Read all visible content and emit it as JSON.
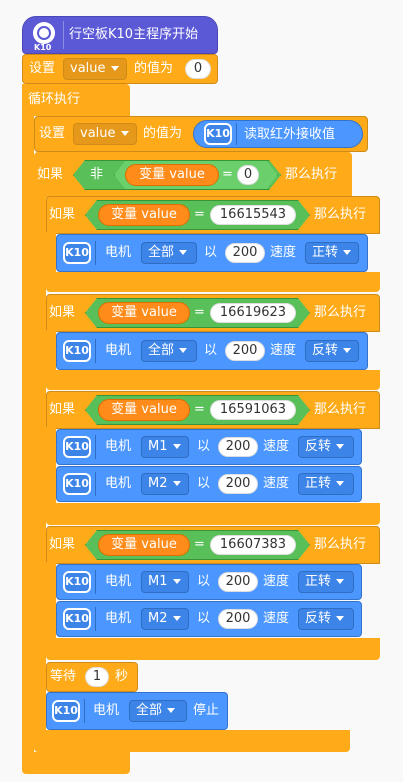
{
  "hat": {
    "icon_label": "K10",
    "label": "行空板K10主程序开始"
  },
  "set_top": {
    "prefix": "设置",
    "var": "value",
    "mid": "的值为",
    "value": "0"
  },
  "loop": {
    "label": "循环执行"
  },
  "set_ir": {
    "prefix": "设置",
    "var": "value",
    "mid": "的值为",
    "reporter": "读取红外接收值"
  },
  "if_not": {
    "if": "如果",
    "not": "非",
    "var": "变量 value",
    "eq": "=",
    "value": "0",
    "then": "那么执行"
  },
  "if_blocks": [
    {
      "if": "如果",
      "var": "变量 value",
      "eq": "=",
      "value": "16615543",
      "then": "那么执行",
      "motors": [
        {
          "label": "电机",
          "motor": "全部",
          "with": "以",
          "speed": "200",
          "speed_label": "速度",
          "dir": "正转"
        }
      ]
    },
    {
      "if": "如果",
      "var": "变量 value",
      "eq": "=",
      "value": "16619623",
      "then": "那么执行",
      "motors": [
        {
          "label": "电机",
          "motor": "全部",
          "with": "以",
          "speed": "200",
          "speed_label": "速度",
          "dir": "反转"
        }
      ]
    },
    {
      "if": "如果",
      "var": "变量 value",
      "eq": "=",
      "value": "16591063",
      "then": "那么执行",
      "motors": [
        {
          "label": "电机",
          "motor": "M1",
          "with": "以",
          "speed": "200",
          "speed_label": "速度",
          "dir": "反转"
        },
        {
          "label": "电机",
          "motor": "M2",
          "with": "以",
          "speed": "200",
          "speed_label": "速度",
          "dir": "正转"
        }
      ]
    },
    {
      "if": "如果",
      "var": "变量 value",
      "eq": "=",
      "value": "16607383",
      "then": "那么执行",
      "motors": [
        {
          "label": "电机",
          "motor": "M1",
          "with": "以",
          "speed": "200",
          "speed_label": "速度",
          "dir": "正转"
        },
        {
          "label": "电机",
          "motor": "M2",
          "with": "以",
          "speed": "200",
          "speed_label": "速度",
          "dir": "反转"
        }
      ]
    }
  ],
  "wait": {
    "label": "等待",
    "value": "1",
    "unit": "秒"
  },
  "stop": {
    "label": "电机",
    "motor": "全部",
    "action": "停止"
  },
  "k10_badge": "K10",
  "colors": {
    "control": "#ffab19",
    "k10": "#4c97ff",
    "operator": "#59c059",
    "variable": "#ff8c1a",
    "hat": "#5b59d6"
  }
}
